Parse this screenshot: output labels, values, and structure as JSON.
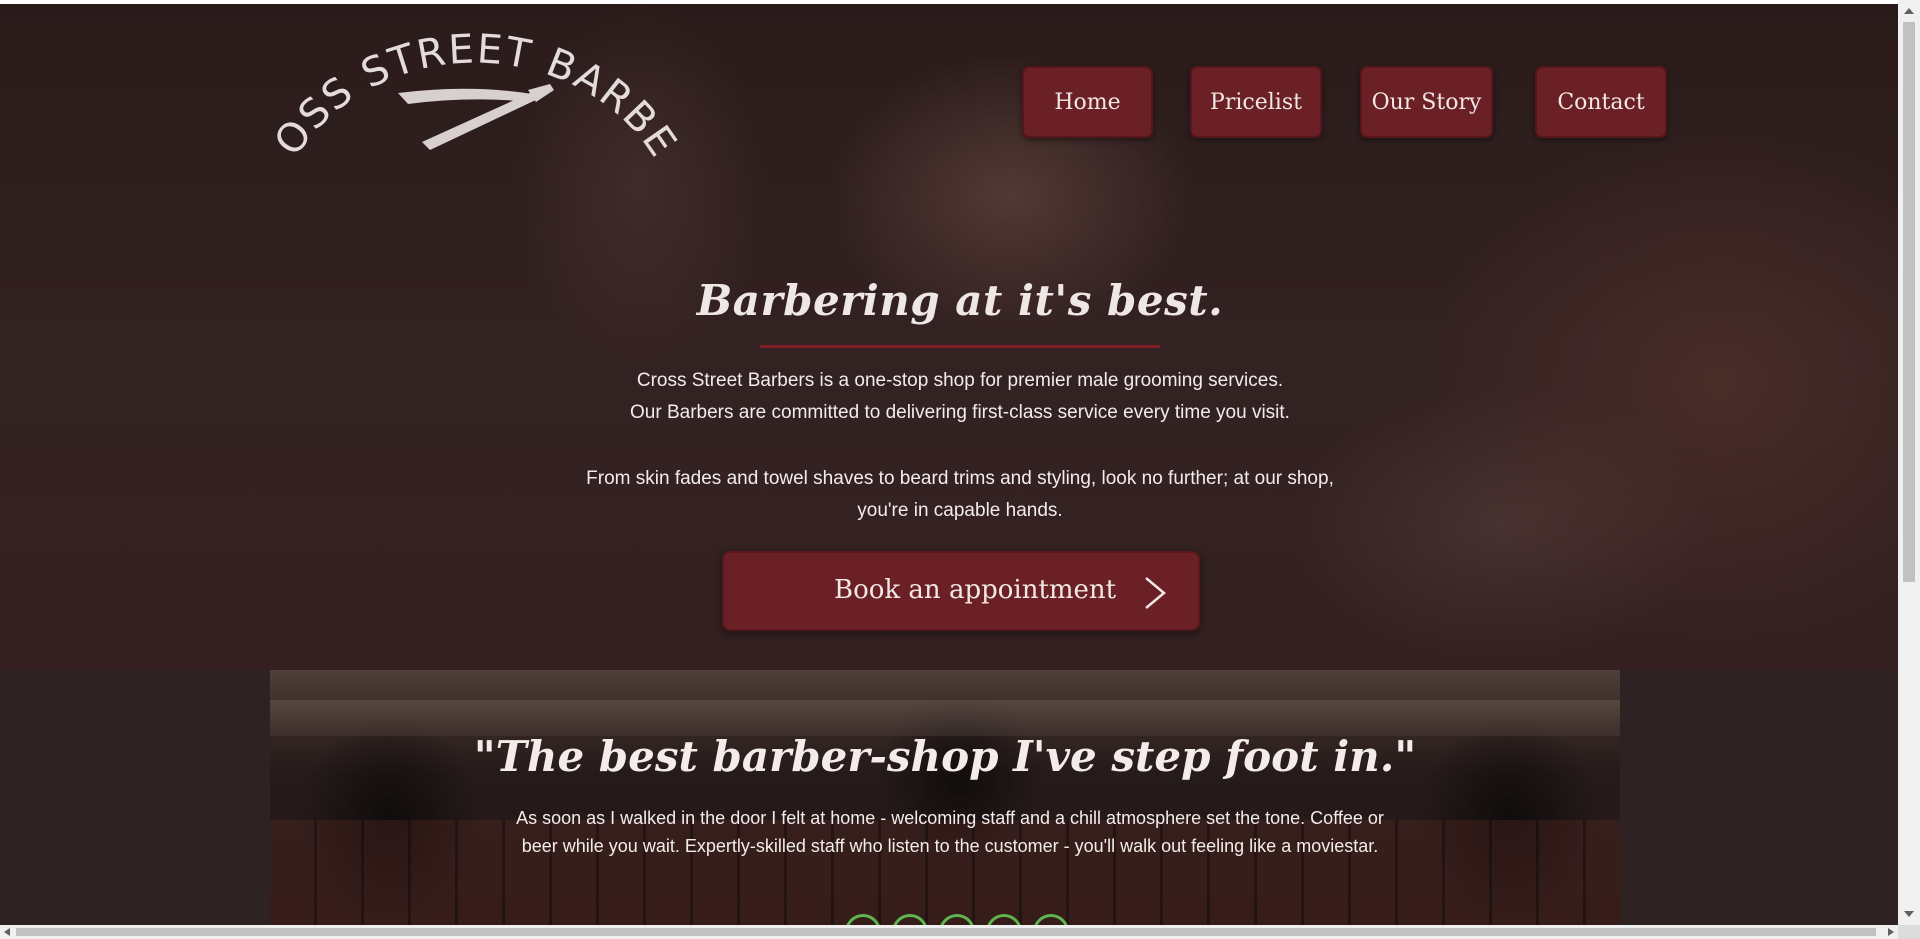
{
  "brand": {
    "logo_text": "CROSS STREET BARBERS",
    "logo_icon": "straight-razor-icon"
  },
  "nav": {
    "items": [
      {
        "label": "Home"
      },
      {
        "label": "Pricelist"
      },
      {
        "label": "Our Story"
      },
      {
        "label": "Contact"
      }
    ]
  },
  "hero": {
    "title": "Barbering at it's best.",
    "para1_line1": "Cross Street Barbers is a one-stop shop for premier male grooming services.",
    "para1_line2": "Our Barbers are committed to delivering first-class service every time you visit.",
    "para2": "From skin fades and towel shaves to beard trims and styling, look no further; at our shop, you're in capable hands.",
    "cta_label": "Book an appointment",
    "cta_icon": "chevron-right-icon"
  },
  "testimonial": {
    "quote": "\"The best barber-shop I've step foot in.\"",
    "text": "As soon as I walked in the door I felt at home - welcoming staff and a chill atmosphere set the tone. Coffee or beer while you wait. Expertly-skilled staff who listen to the customer - you'll walk out feeling like a moviestar.",
    "rating_count": 5,
    "rating_color": "#5fb54f"
  },
  "colors": {
    "accent": "#6b2025",
    "underline": "#7f1e25",
    "text": "#f2eceb"
  }
}
